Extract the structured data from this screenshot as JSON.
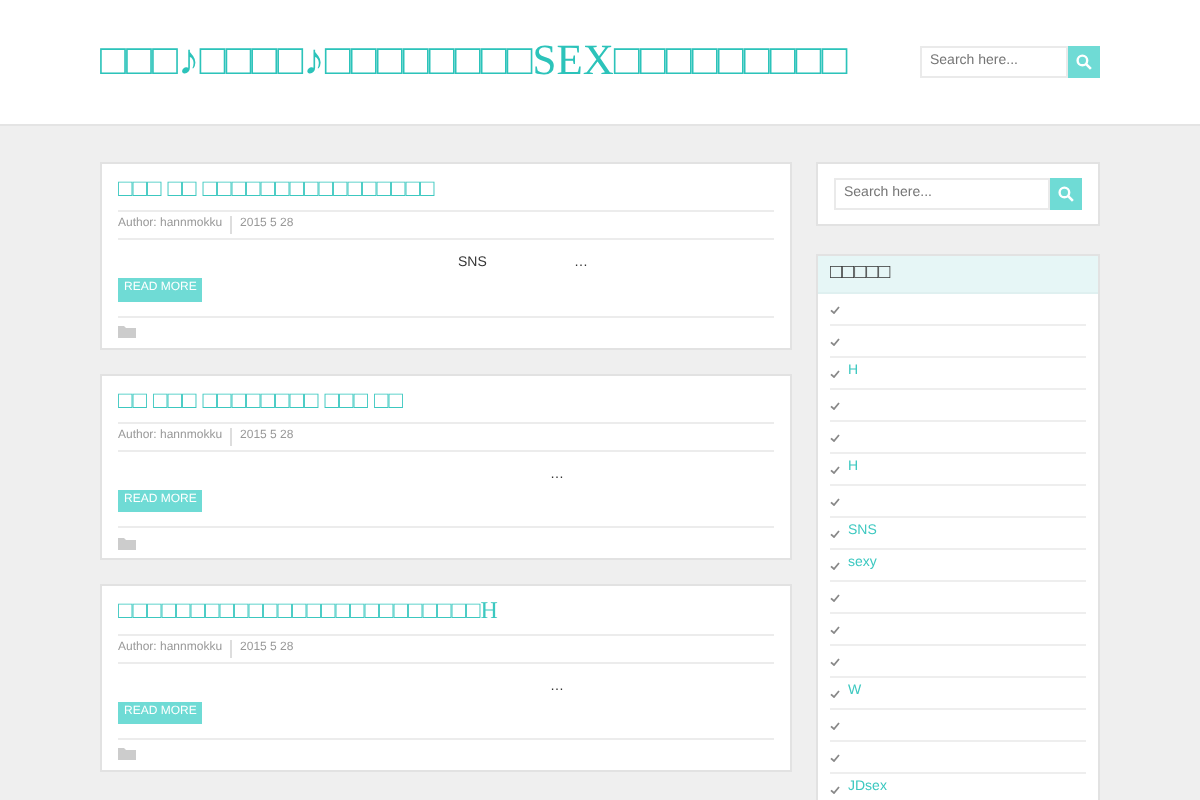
{
  "header": {
    "site_title": "□□□♪□□□□♪□□□□□□□□SEX□□□□□□□□□",
    "search": {
      "placeholder": "Search here..."
    }
  },
  "posts": [
    {
      "title": "□□□ □□ □□□□□□□□□□□□□□□□",
      "author": "Author: hannmokku",
      "date": "2015 5 28",
      "excerpt": [
        "SNS",
        "…"
      ],
      "button": "READ MORE"
    },
    {
      "title": "□□ □□□ □□□□□□□□ □□□ □□",
      "author": "Author: hannmokku",
      "date": "2015 5 28",
      "excerpt": [
        "…"
      ],
      "button": "READ MORE"
    },
    {
      "title": "□□□□□□□□□□□□□□□□□□□□□□□□□H",
      "author": "Author: hannmokku",
      "date": "2015 5 28",
      "excerpt": [
        "…"
      ],
      "button": "READ MORE"
    }
  ],
  "sidebar": {
    "search": {
      "placeholder": "Search here..."
    },
    "widget_title": "□□□□□",
    "items": [
      {
        "kind": "empty"
      },
      {
        "kind": "empty"
      },
      {
        "kind": "link",
        "text": "H"
      },
      {
        "kind": "empty"
      },
      {
        "kind": "empty"
      },
      {
        "kind": "link",
        "text": "H"
      },
      {
        "kind": "empty"
      },
      {
        "kind": "link",
        "text": "SNS"
      },
      {
        "kind": "link",
        "text": "sexy"
      },
      {
        "kind": "empty"
      },
      {
        "kind": "empty"
      },
      {
        "kind": "empty"
      },
      {
        "kind": "link",
        "text": "W"
      },
      {
        "kind": "empty"
      },
      {
        "kind": "empty"
      },
      {
        "kind": "link",
        "text": "JDsex"
      }
    ]
  }
}
